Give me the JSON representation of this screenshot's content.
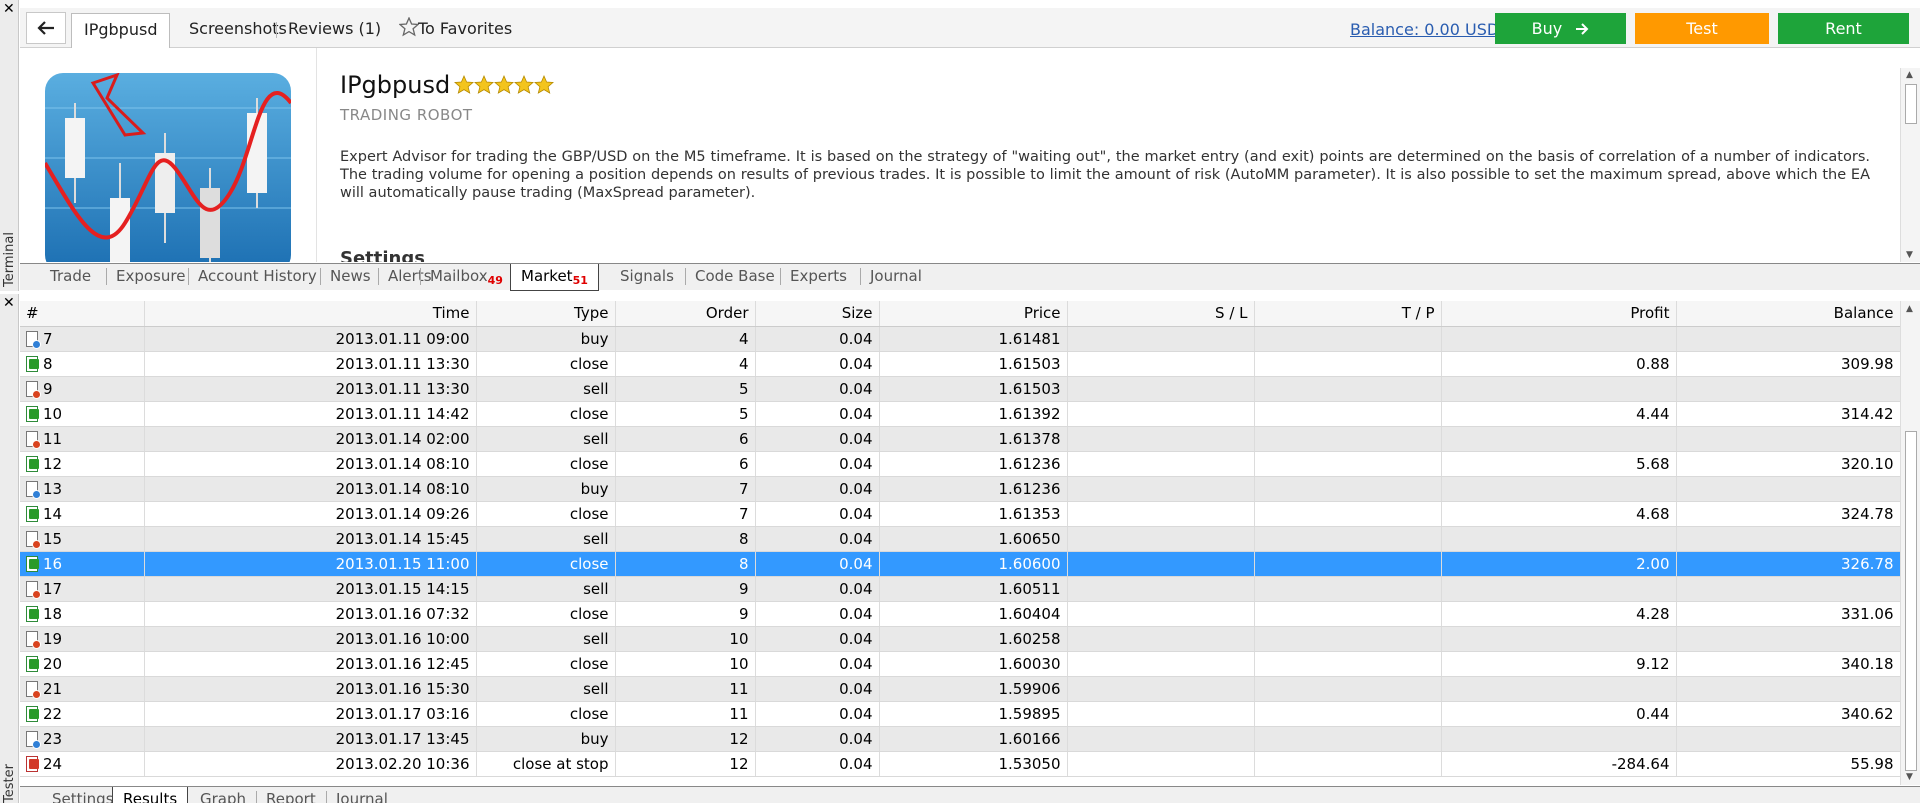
{
  "terminal_label": "Terminal",
  "tester_label": "Tester",
  "topbar": {
    "tabs": [
      "IPgbpusd",
      "Screenshots",
      "Reviews (1)",
      "To Favorites"
    ],
    "balance": "Balance: 0.00 USD",
    "buttons": {
      "buy": "Buy",
      "test": "Test",
      "rent": "Rent"
    },
    "colors": {
      "buy": "#1ea43a",
      "test": "#ff9900",
      "rent": "#1ea43a"
    }
  },
  "product": {
    "title": "IPgbpusd",
    "rating": 5,
    "subtitle": "TRADING ROBOT",
    "description": "Expert Advisor for trading the GBP/USD on the M5 timeframe. It is based on the strategy of \"waiting out\", the market entry (and exit) points are determined on the basis of correlation of a number of indicators. The trading volume for opening a position depends on results of previous trades. It is possible to limit the amount of risk (AutoMM parameter). It is also possible to set the maximum spread, above which the EA will automatically pause trading (MaxSpread parameter).",
    "settings_heading": "Settings"
  },
  "terminal_tabs": [
    {
      "label": "Trade"
    },
    {
      "label": "Exposure"
    },
    {
      "label": "Account History"
    },
    {
      "label": "News"
    },
    {
      "label": "Alerts"
    },
    {
      "label": "Mailbox",
      "badge": "49"
    },
    {
      "label": "Market",
      "badge": "51",
      "active": true
    },
    {
      "label": "Signals"
    },
    {
      "label": "Code Base"
    },
    {
      "label": "Experts"
    },
    {
      "label": "Journal"
    }
  ],
  "results": {
    "columns": [
      "#",
      "Time",
      "Type",
      "Order",
      "Size",
      "Price",
      "S / L",
      "T / P",
      "Profit",
      "Balance"
    ],
    "rows": [
      {
        "n": "7",
        "time": "2013.01.11 09:00",
        "type": "buy",
        "order": "4",
        "size": "0.04",
        "price": "1.61481",
        "sl": "",
        "tp": "",
        "profit": "",
        "balance": "",
        "icon": "buy"
      },
      {
        "n": "8",
        "time": "2013.01.11 13:30",
        "type": "close",
        "order": "4",
        "size": "0.04",
        "price": "1.61503",
        "sl": "",
        "tp": "",
        "profit": "0.88",
        "balance": "309.98",
        "icon": "close"
      },
      {
        "n": "9",
        "time": "2013.01.11 13:30",
        "type": "sell",
        "order": "5",
        "size": "0.04",
        "price": "1.61503",
        "sl": "",
        "tp": "",
        "profit": "",
        "balance": "",
        "icon": "sell"
      },
      {
        "n": "10",
        "time": "2013.01.11 14:42",
        "type": "close",
        "order": "5",
        "size": "0.04",
        "price": "1.61392",
        "sl": "",
        "tp": "",
        "profit": "4.44",
        "balance": "314.42",
        "icon": "close"
      },
      {
        "n": "11",
        "time": "2013.01.14 02:00",
        "type": "sell",
        "order": "6",
        "size": "0.04",
        "price": "1.61378",
        "sl": "",
        "tp": "",
        "profit": "",
        "balance": "",
        "icon": "sell"
      },
      {
        "n": "12",
        "time": "2013.01.14 08:10",
        "type": "close",
        "order": "6",
        "size": "0.04",
        "price": "1.61236",
        "sl": "",
        "tp": "",
        "profit": "5.68",
        "balance": "320.10",
        "icon": "close"
      },
      {
        "n": "13",
        "time": "2013.01.14 08:10",
        "type": "buy",
        "order": "7",
        "size": "0.04",
        "price": "1.61236",
        "sl": "",
        "tp": "",
        "profit": "",
        "balance": "",
        "icon": "buy"
      },
      {
        "n": "14",
        "time": "2013.01.14 09:26",
        "type": "close",
        "order": "7",
        "size": "0.04",
        "price": "1.61353",
        "sl": "",
        "tp": "",
        "profit": "4.68",
        "balance": "324.78",
        "icon": "close"
      },
      {
        "n": "15",
        "time": "2013.01.14 15:45",
        "type": "sell",
        "order": "8",
        "size": "0.04",
        "price": "1.60650",
        "sl": "",
        "tp": "",
        "profit": "",
        "balance": "",
        "icon": "sell"
      },
      {
        "n": "16",
        "time": "2013.01.15 11:00",
        "type": "close",
        "order": "8",
        "size": "0.04",
        "price": "1.60600",
        "sl": "",
        "tp": "",
        "profit": "2.00",
        "balance": "326.78",
        "icon": "close",
        "selected": true
      },
      {
        "n": "17",
        "time": "2013.01.15 14:15",
        "type": "sell",
        "order": "9",
        "size": "0.04",
        "price": "1.60511",
        "sl": "",
        "tp": "",
        "profit": "",
        "balance": "",
        "icon": "sell"
      },
      {
        "n": "18",
        "time": "2013.01.16 07:32",
        "type": "close",
        "order": "9",
        "size": "0.04",
        "price": "1.60404",
        "sl": "",
        "tp": "",
        "profit": "4.28",
        "balance": "331.06",
        "icon": "close"
      },
      {
        "n": "19",
        "time": "2013.01.16 10:00",
        "type": "sell",
        "order": "10",
        "size": "0.04",
        "price": "1.60258",
        "sl": "",
        "tp": "",
        "profit": "",
        "balance": "",
        "icon": "sell"
      },
      {
        "n": "20",
        "time": "2013.01.16 12:45",
        "type": "close",
        "order": "10",
        "size": "0.04",
        "price": "1.60030",
        "sl": "",
        "tp": "",
        "profit": "9.12",
        "balance": "340.18",
        "icon": "close"
      },
      {
        "n": "21",
        "time": "2013.01.16 15:30",
        "type": "sell",
        "order": "11",
        "size": "0.04",
        "price": "1.59906",
        "sl": "",
        "tp": "",
        "profit": "",
        "balance": "",
        "icon": "sell"
      },
      {
        "n": "22",
        "time": "2013.01.17 03:16",
        "type": "close",
        "order": "11",
        "size": "0.04",
        "price": "1.59895",
        "sl": "",
        "tp": "",
        "profit": "0.44",
        "balance": "340.62",
        "icon": "close"
      },
      {
        "n": "23",
        "time": "2013.01.17 13:45",
        "type": "buy",
        "order": "12",
        "size": "0.04",
        "price": "1.60166",
        "sl": "",
        "tp": "",
        "profit": "",
        "balance": "",
        "icon": "buy"
      },
      {
        "n": "24",
        "time": "2013.02.20 10:36",
        "type": "close at stop",
        "order": "12",
        "size": "0.04",
        "price": "1.53050",
        "sl": "",
        "tp": "",
        "profit": "-284.64",
        "balance": "55.98",
        "icon": "stop"
      }
    ]
  },
  "tester_tabs": [
    {
      "label": "Settings"
    },
    {
      "label": "Results",
      "active": true
    },
    {
      "label": "Graph"
    },
    {
      "label": "Report"
    },
    {
      "label": "Journal"
    }
  ],
  "colors": {
    "selection": "#3399ff",
    "badge": "#e00000",
    "link": "#2a5db0"
  }
}
